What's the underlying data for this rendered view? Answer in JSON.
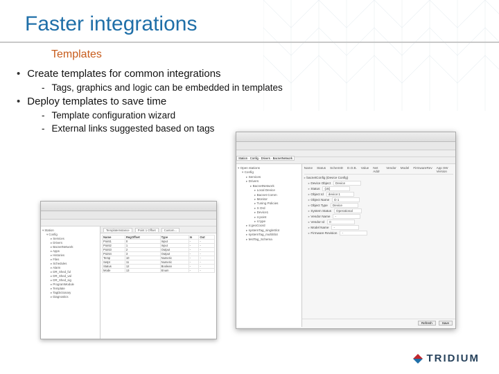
{
  "slide": {
    "title": "Faster integrations",
    "subtitle": "Templates",
    "bullets": [
      {
        "text": "Create templates for common integrations",
        "subs": [
          "Tags, graphics and logic can be embedded in templates"
        ]
      },
      {
        "text": "Deploy templates to save time",
        "subs": [
          "Template configuration wizard",
          "External links suggested based on tags"
        ]
      }
    ]
  },
  "screenshot1": {
    "tabs": [
      "TemplateInstance",
      "Point 1 Offset",
      "Custom..."
    ],
    "tree": [
      "Station",
      "  Config",
      "    Services",
      "    Drivers",
      "    BacnetNetwork",
      "    Apps",
      "    Histories",
      "    Files",
      "    Schedules",
      "    Alarm",
      "    DR_Shed_ful",
      "    DR_Shed_val",
      "    DR_Shed_sig",
      "    ProgramModule",
      "    Template",
      "    TagDictionary",
      "    Diagnostics"
    ],
    "gridHeaders": [
      "Name",
      "RegOffset",
      "Type",
      "In",
      "Out"
    ],
    "gridRows": [
      [
        "Point1",
        "0",
        "Input",
        "-",
        "-"
      ],
      [
        "Point2",
        "1",
        "Input",
        "-",
        "-"
      ],
      [
        "Point3",
        "2",
        "Output",
        "-",
        "-"
      ],
      [
        "Point4",
        "3",
        "Output",
        "-",
        "-"
      ],
      [
        "Temp",
        "10",
        "Numeric",
        "-",
        "-"
      ],
      [
        "Setpt",
        "11",
        "Numeric",
        "-",
        "-"
      ],
      [
        "Status",
        "12",
        "Boolean",
        "-",
        "-"
      ],
      [
        "Mode",
        "13",
        "Enum",
        "-",
        "-"
      ]
    ]
  },
  "screenshot2": {
    "breadcrumbsLabel": "Station · Config · Drivers · BacnetNetwork",
    "tree": [
      "Open stations",
      "  Config",
      "    Services",
      "    Drivers",
      "      BacnetNetwork",
      "        Local Device",
      "        Bacnet Comm",
      "        Monitor",
      "        Tuning Policies",
      "        X Ord",
      "        Device1",
      "        n:point",
      "        n:type",
      "    n:geoCoord",
      "    systemTag_singleSlot",
      "    systemTag_multiSlot",
      "    testTag_Schema"
    ],
    "propsHeader": [
      "Name",
      "Status",
      "SchemID",
      "D.O.B.",
      "Value",
      "Net Addr",
      "Vendor",
      "Model",
      "FirmwareRev",
      "App SW Version"
    ],
    "configTitle": "bacnetConfig (Device Config)",
    "configRows": [
      [
        "Device Object",
        "Device"
      ],
      [
        "Status",
        "{ok}"
      ],
      [
        "Object Id",
        "device:1"
      ],
      [
        "Object Name",
        "D 1"
      ],
      [
        "Object Type",
        "Device"
      ],
      [
        "System Status",
        "Operational"
      ],
      [
        "Vendor Name",
        "-"
      ],
      [
        "Vendor Id",
        "0"
      ],
      [
        "Model Name",
        "-"
      ],
      [
        "Firmware Revision",
        "-"
      ]
    ],
    "buttons": [
      "Refresh",
      "Save"
    ]
  },
  "brand": "TRIDIUM"
}
